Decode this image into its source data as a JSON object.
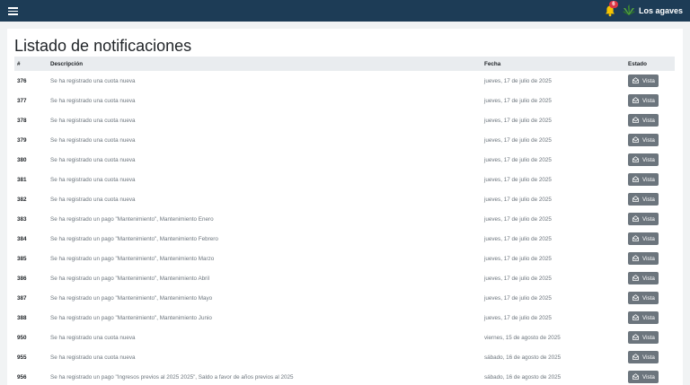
{
  "navbar": {
    "brand_name": "Los agaves",
    "notification_count": "6",
    "background_color": "#1d3c56",
    "icons": [
      "menu-icon",
      "bell-icon",
      "agave-logo-icon"
    ]
  },
  "page": {
    "title": "Listado de notificaciones"
  },
  "table": {
    "columns": [
      "#",
      "Descripción",
      "Fecha",
      "Estado"
    ],
    "action_label": "Vista",
    "action_icon": "envelope-open-icon",
    "rows": [
      {
        "id": "376",
        "description": "Se ha registrado una cuota nueva",
        "date": "jueves, 17 de julio de 2025"
      },
      {
        "id": "377",
        "description": "Se ha registrado una cuota nueva",
        "date": "jueves, 17 de julio de 2025"
      },
      {
        "id": "378",
        "description": "Se ha registrado una cuota nueva",
        "date": "jueves, 17 de julio de 2025"
      },
      {
        "id": "379",
        "description": "Se ha registrado una cuota nueva",
        "date": "jueves, 17 de julio de 2025"
      },
      {
        "id": "380",
        "description": "Se ha registrado una cuota nueva",
        "date": "jueves, 17 de julio de 2025"
      },
      {
        "id": "381",
        "description": "Se ha registrado una cuota nueva",
        "date": "jueves, 17 de julio de 2025"
      },
      {
        "id": "382",
        "description": "Se ha registrado una cuota nueva",
        "date": "jueves, 17 de julio de 2025"
      },
      {
        "id": "383",
        "description": "Se ha registrado un pago \"Mantenimiento\", Mantenimiento Enero",
        "date": "jueves, 17 de julio de 2025"
      },
      {
        "id": "384",
        "description": "Se ha registrado un pago \"Mantenimiento\", Mantenimiento Febrero",
        "date": "jueves, 17 de julio de 2025"
      },
      {
        "id": "385",
        "description": "Se ha registrado un pago \"Mantenimiento\", Mantenimiento Marzo",
        "date": "jueves, 17 de julio de 2025"
      },
      {
        "id": "386",
        "description": "Se ha registrado un pago \"Mantenimiento\", Mantenimiento Abril",
        "date": "jueves, 17 de julio de 2025"
      },
      {
        "id": "387",
        "description": "Se ha registrado un pago \"Mantenimiento\", Mantenimiento Mayo",
        "date": "jueves, 17 de julio de 2025"
      },
      {
        "id": "388",
        "description": "Se ha registrado un pago \"Mantenimiento\", Mantenimiento Junio",
        "date": "jueves, 17 de julio de 2025"
      },
      {
        "id": "950",
        "description": "Se ha registrado una cuota nueva",
        "date": "viernes, 15 de agosto de 2025"
      },
      {
        "id": "955",
        "description": "Se ha registrado una cuota nueva",
        "date": "sábado, 16 de agosto de 2025"
      },
      {
        "id": "956",
        "description": "Se ha registrado un pago \"Ingresos previos al 2025 2025\", Saldo a favor de años previos al 2025",
        "date": "sábado, 16 de agosto de 2025"
      }
    ]
  }
}
